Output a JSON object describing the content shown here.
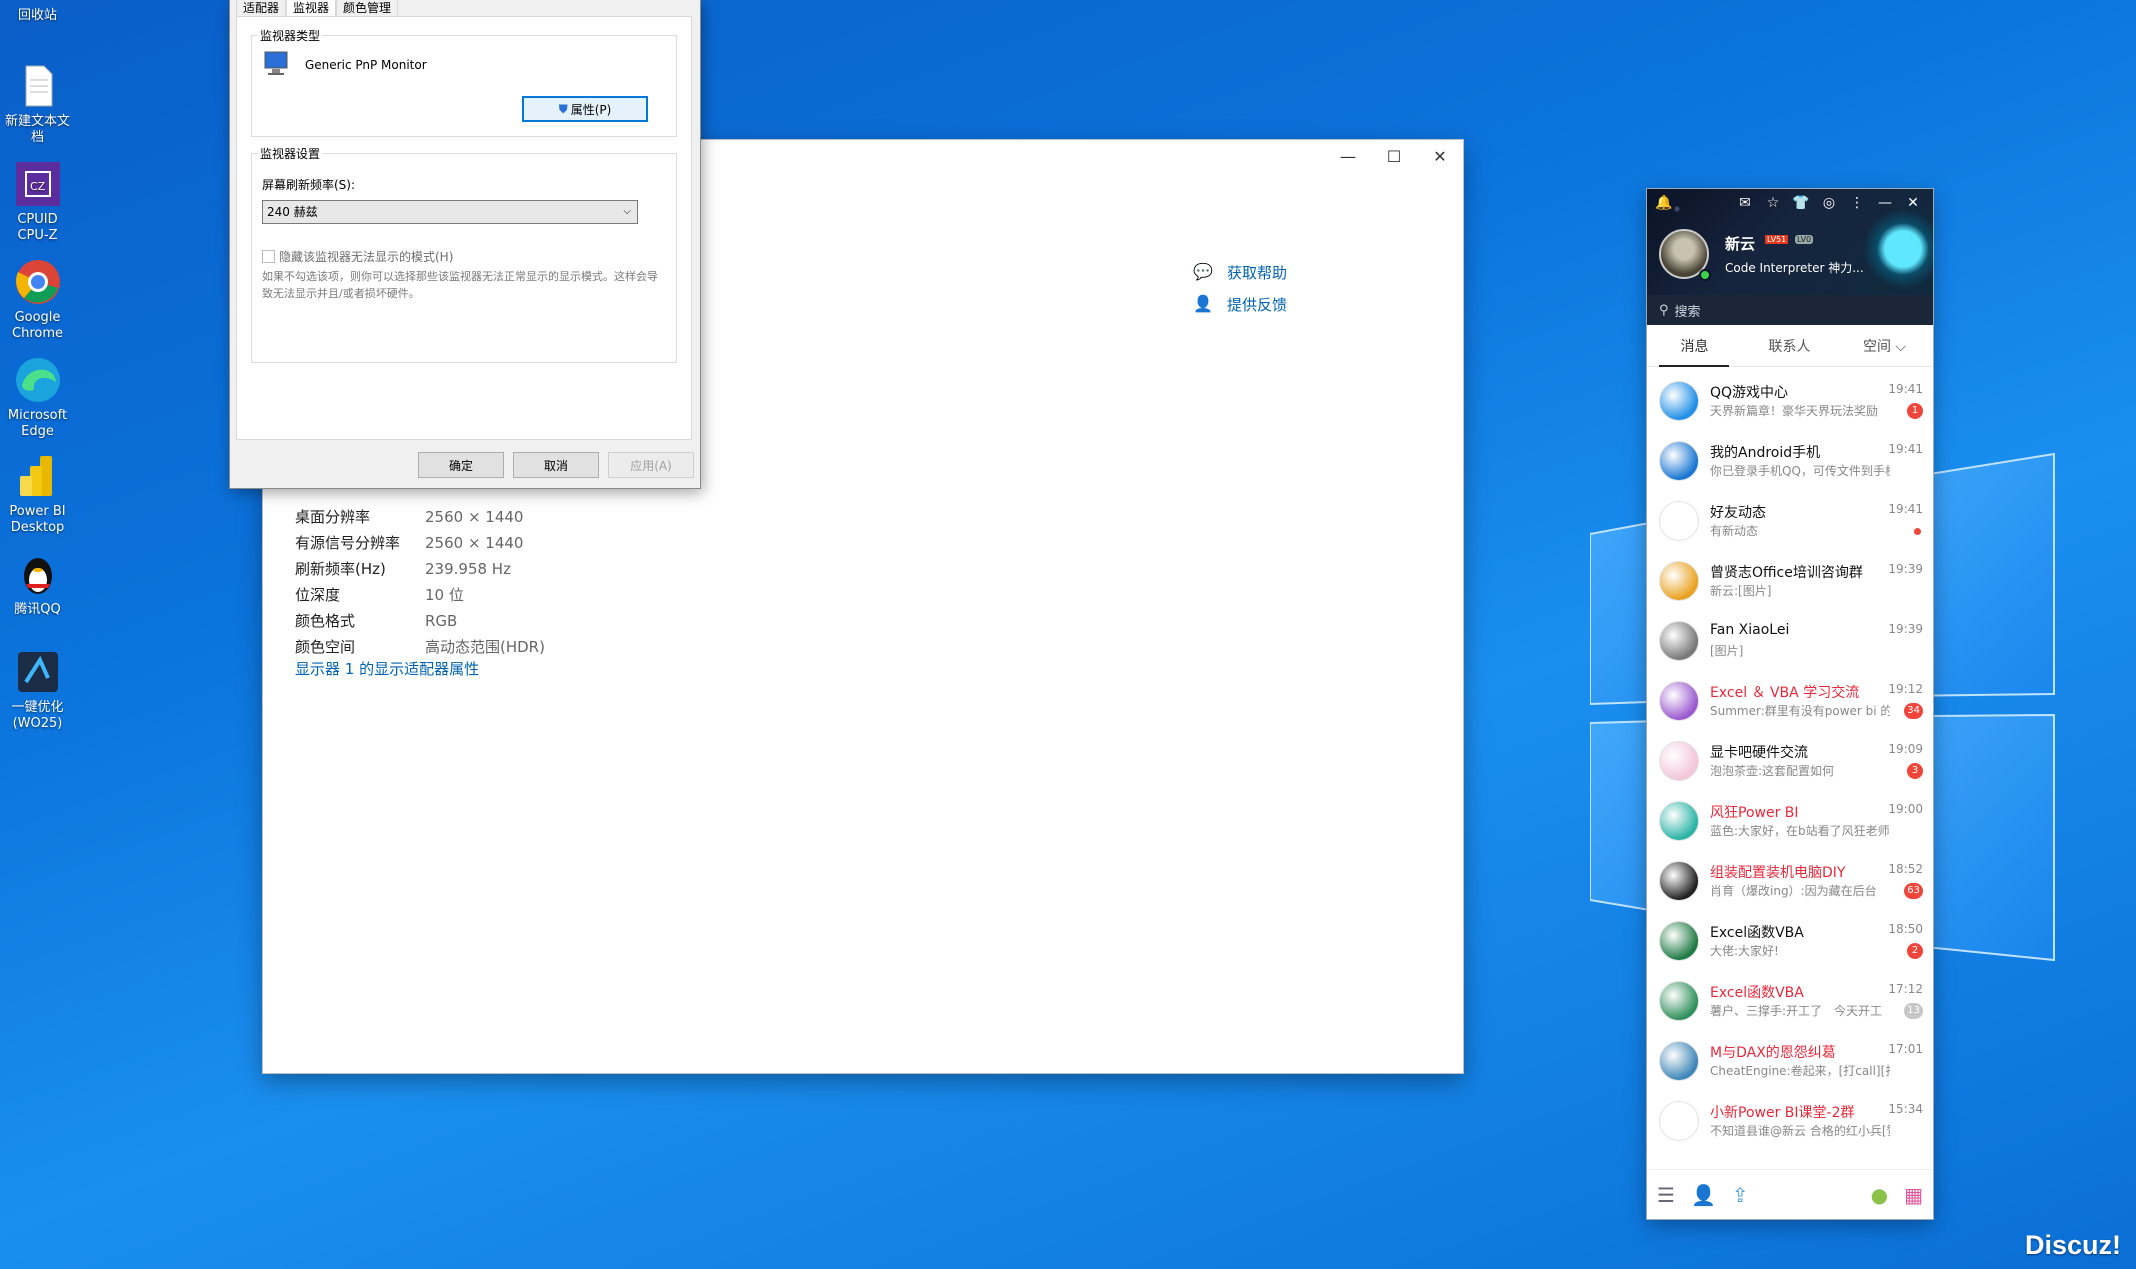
{
  "desktop": {
    "icons": [
      {
        "label": "回收站",
        "icon": "recycle-bin-icon"
      },
      {
        "label": "新建文本文档",
        "icon": "text-document-icon"
      },
      {
        "label": "CPUID CPU-Z",
        "icon": "cpuz-icon"
      },
      {
        "label": "Google Chrome",
        "icon": "chrome-icon"
      },
      {
        "label": "Microsoft Edge",
        "icon": "edge-icon"
      },
      {
        "label": "Power BI Desktop",
        "icon": "powerbi-icon"
      },
      {
        "label": "腾讯QQ",
        "icon": "qq-icon"
      },
      {
        "label": "一键优化(WO25)",
        "icon": "optimize-icon"
      }
    ],
    "watermark": "Discuz!"
  },
  "settings_window": {
    "help": {
      "get_help": "获取帮助",
      "feedback": "提供反馈"
    },
    "rows": [
      {
        "k": "桌面分辨率",
        "v": "2560 × 1440"
      },
      {
        "k": "有源信号分辨率",
        "v": "2560 × 1440"
      },
      {
        "k": "刷新频率(Hz)",
        "v": "239.958 Hz"
      },
      {
        "k": "位深度",
        "v": "10 位"
      },
      {
        "k": "颜色格式",
        "v": "RGB"
      },
      {
        "k": "颜色空间",
        "v": "高动态范围(HDR)"
      }
    ],
    "adapter_link": "显示器 1 的显示适配器属性"
  },
  "properties_dialog": {
    "tabs": [
      "适配器",
      "监视器",
      "颜色管理"
    ],
    "monitor_type_group": "监视器类型",
    "monitor_name": "Generic PnP Monitor",
    "properties_button": "属性(P)",
    "monitor_settings_group": "监视器设置",
    "refresh_label": "屏幕刷新频率(S):",
    "refresh_value": "240 赫兹",
    "hide_modes_label": "隐藏该监视器无法显示的模式(H)",
    "note": "如果不勾选该项，则你可以选择那些该监视器无法正常显示的显示模式。这样会导致无法显示并且/或者损坏硬件。",
    "ok": "确定",
    "cancel": "取消",
    "apply": "应用(A)"
  },
  "qq": {
    "nickname": "新云",
    "level_badge": "LV51",
    "level_badge2": "LV0",
    "signature": "Code Interpreter 神力...",
    "search_placeholder": "搜索",
    "tabs": [
      "消息",
      "联系人",
      "空间 ⌵"
    ],
    "chats": [
      {
        "name": "QQ游戏中心",
        "preview": "天界新篇章！豪华天界玩法奖励",
        "time": "19:41",
        "badge": "1",
        "red": false,
        "color": "#1e8fe6"
      },
      {
        "name": "我的Android手机",
        "preview": "你已登录手机QQ，可传文件到手机",
        "time": "19:41",
        "badge": "",
        "red": false,
        "color": "#1976d2"
      },
      {
        "name": "好友动态",
        "preview": "有新动态",
        "time": "19:41",
        "badge": "dot",
        "red": false,
        "color": "#ffffff"
      },
      {
        "name": "曾贤志Office培训咨询群",
        "preview": "新云:[图片]",
        "time": "19:39",
        "badge": "",
        "red": false,
        "color": "#e9a21f"
      },
      {
        "name": "Fan XiaoLei",
        "preview": "[图片]",
        "time": "19:39",
        "badge": "",
        "red": false,
        "color": "#777777"
      },
      {
        "name": "Excel ＆ VBA 学习交流",
        "preview": "Summer:群里有没有power bi 的",
        "time": "19:12",
        "badge": "34",
        "red": true,
        "color": "#9b59d0"
      },
      {
        "name": "显卡吧硬件交流",
        "preview": "泡泡茶壶:这套配置如何",
        "time": "19:09",
        "badge": "3",
        "red": false,
        "color": "#f3c6d8"
      },
      {
        "name": "风狂Power BI",
        "preview": "蓝色:大家好，在b站看了风狂老师的课",
        "time": "19:00",
        "badge": "",
        "red": true,
        "color": "#2ab3a6"
      },
      {
        "name": "组装配置装机电脑DIY",
        "preview": "肖育（爆改ing）:因为藏在后台",
        "time": "18:52",
        "badge": "63",
        "red": true,
        "color": "#222222"
      },
      {
        "name": "Excel函数VBA",
        "preview": "大佬:大家好!",
        "time": "18:50",
        "badge": "2",
        "red": false,
        "color": "#1f7a44"
      },
      {
        "name": "Excel函数VBA",
        "preview": "薯户、三撑手:开工了　今天开工",
        "time": "17:12",
        "badge": "13",
        "red": true,
        "color": "#2f8f5b"
      },
      {
        "name": "M与DAX的恩怨纠葛",
        "preview": "CheatEngine:卷起来，[打call][打call]",
        "time": "17:01",
        "badge": "",
        "red": true,
        "color": "#3f86b8"
      },
      {
        "name": "小新Power BI课堂-2群",
        "preview": "不知道县谁@新云 合格的红小兵[赞]",
        "time": "15:34",
        "badge": "",
        "red": true,
        "color": "#ffffff"
      }
    ]
  }
}
